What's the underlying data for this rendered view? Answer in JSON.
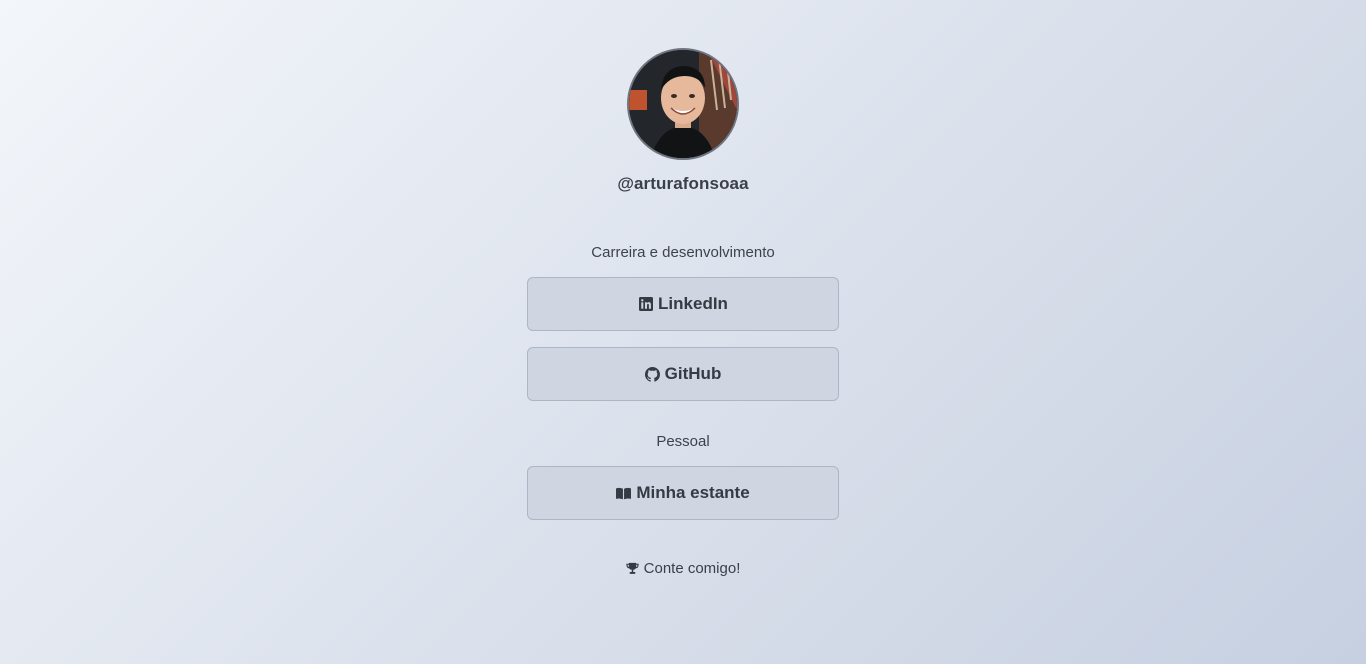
{
  "profile": {
    "handle": "@arturafonsoaa",
    "avatar_alt": "profile photo"
  },
  "sections": [
    {
      "title": "Carreira e desenvolvimento",
      "links": [
        {
          "label": "LinkedIn",
          "icon": "linkedin-icon"
        },
        {
          "label": "GitHub",
          "icon": "github-icon"
        }
      ]
    },
    {
      "title": "Pessoal",
      "links": [
        {
          "label": "Minha estante",
          "icon": "book-open-icon"
        }
      ]
    }
  ],
  "footer": {
    "text": "Conte comigo!",
    "icon": "trophy-icon"
  },
  "colors": {
    "button_bg": "#cfd6e2",
    "button_border": "#aeb6c4",
    "text": "#353a43"
  }
}
